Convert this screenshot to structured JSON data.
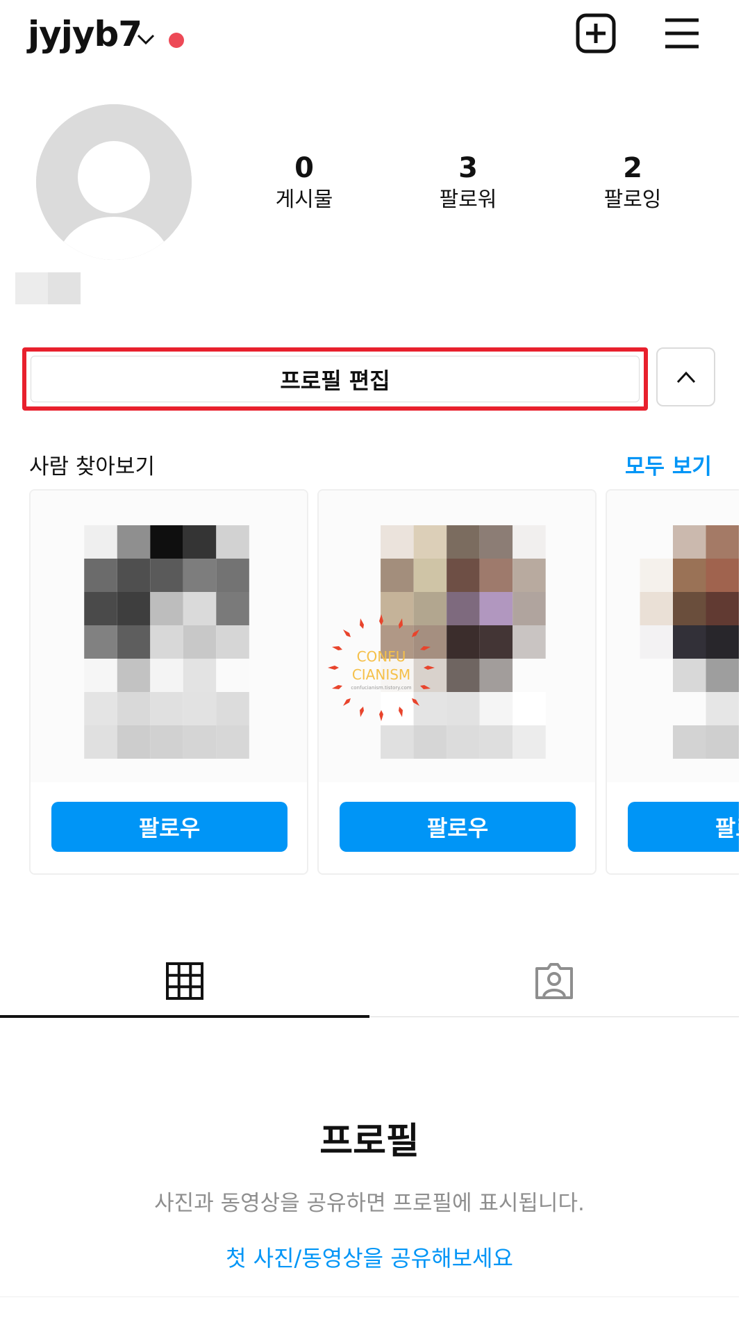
{
  "header": {
    "username": "jyjyb7"
  },
  "stats": [
    {
      "value": "0",
      "label": "게시물"
    },
    {
      "value": "3",
      "label": "팔로워"
    },
    {
      "value": "2",
      "label": "팔로잉"
    }
  ],
  "profile": {
    "edit_label": "프로필 편집"
  },
  "suggestions": {
    "title": "사람 찾아보기",
    "see_all": "모두 보기",
    "cards": [
      {
        "follow_label": "팔로우"
      },
      {
        "follow_label": "팔로우"
      },
      {
        "follow_label": "팔로우"
      }
    ]
  },
  "watermark": {
    "line1": "CONFU",
    "line2": "CIANISM",
    "line3": "confucianism.tistory.com"
  },
  "tabs": [
    {
      "icon": "grid-icon",
      "active": true
    },
    {
      "icon": "tagged-person-icon",
      "active": false
    }
  ],
  "empty_state": {
    "title": "프로필",
    "description": "사진과 동영상을 공유하면 프로필에 표시됩니다.",
    "cta": "첫 사진/동영상을 공유해보세요"
  },
  "colors": {
    "accent": "#0095f6",
    "notification_dot": "#ed4956",
    "highlight_box": "#e8202d"
  }
}
